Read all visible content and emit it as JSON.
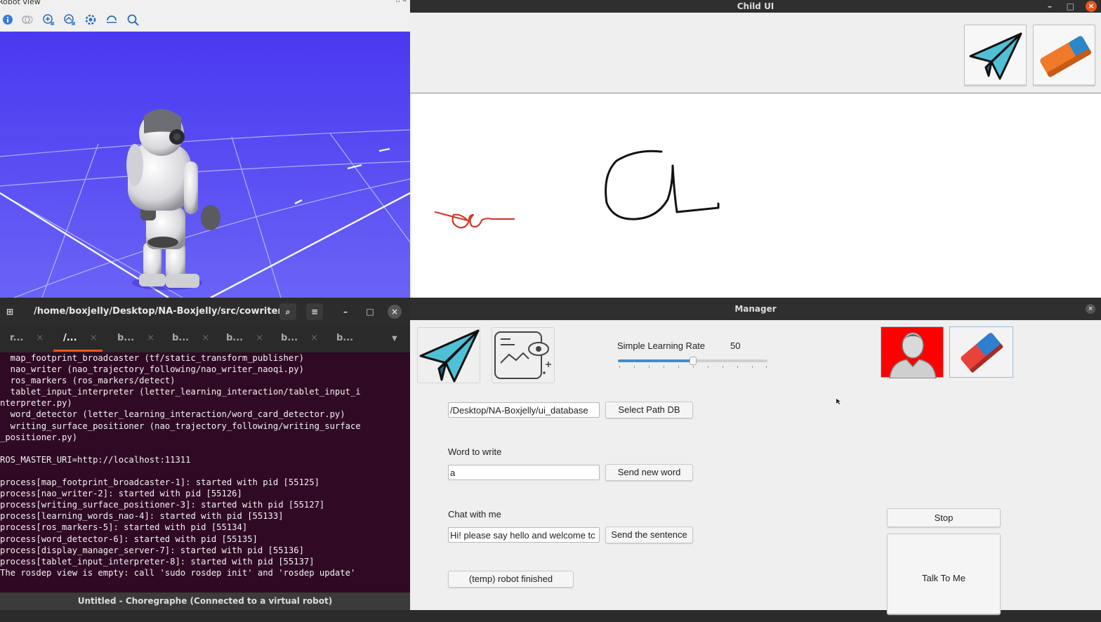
{
  "robot_view": {
    "title": "Robot view",
    "toolbar_icons": [
      "info-icon",
      "toggle-icon",
      "view-icon",
      "view-icon",
      "settings-icon",
      "rotate-icon",
      "zoom-icon"
    ]
  },
  "child_ui": {
    "title": "Child UI",
    "window_controls": {
      "minimize": "–",
      "maximize": "□",
      "close": "×"
    },
    "send_icon": "paper-plane-icon",
    "erase_icon": "eraser-icon",
    "drawing": {
      "robot_stroke_color": "#d23a2a",
      "child_stroke_color": "#111111"
    }
  },
  "terminal": {
    "path": "/home/boxjelly/Desktop/NA-Boxjelly/src/cowriter...",
    "tabs": [
      "r...",
      "/...",
      "b...",
      "b...",
      "b...",
      "b...",
      "b..."
    ],
    "active_tab": 1,
    "tab_close": "×",
    "lines": [
      "  map_footprint_broadcaster (tf/static_transform_publisher)",
      "  nao_writer (nao_trajectory_following/nao_writer_naoqi.py)",
      "  ros_markers (ros_markers/detect)",
      "  tablet_input_interpreter (letter_learning_interaction/tablet_input_i",
      "nterpreter.py)",
      "  word_detector (letter_learning_interaction/word_card_detector.py)",
      "  writing_surface_positioner (nao_trajectory_following/writing_surface",
      "_positioner.py)",
      "",
      "ROS_MASTER_URI=http://localhost:11311",
      "",
      "process[map_footprint_broadcaster-1]: started with pid [55125]",
      "process[nao_writer-2]: started with pid [55126]",
      "process[writing_surface_positioner-3]: started with pid [55127]",
      "process[learning_words_nao-4]: started with pid [55133]",
      "process[ros_markers-5]: started with pid [55134]",
      "process[word_detector-6]: started with pid [55135]",
      "process[display_manager_server-7]: started with pid [55136]",
      "process[tablet_input_interpreter-8]: started with pid [55137]",
      "The rosdep view is empty: call 'sudo rosdep init' and 'rosdep update'"
    ],
    "bottom_bar": "Untitled - Choregraphe (Connected to a virtual robot)"
  },
  "manager": {
    "title": "Manager",
    "close": "×",
    "learning_rate": {
      "label": "Simple Learning Rate",
      "value": "50",
      "fraction": 0.5
    },
    "path_db": {
      "value": "/Desktop/NA-Boxjelly/ui_database",
      "button": "Select Path DB"
    },
    "word": {
      "label": "Word to write",
      "value": "a",
      "button": "Send new word"
    },
    "chat": {
      "label": "Chat with me",
      "value": "Hi! please say hello and welcome tc",
      "button": "Send the sentence"
    },
    "robot_finished_button": "(temp) robot finished",
    "stop_button": "Stop",
    "talk_button": "Talk To Me",
    "accent_red": "#ff0000"
  }
}
